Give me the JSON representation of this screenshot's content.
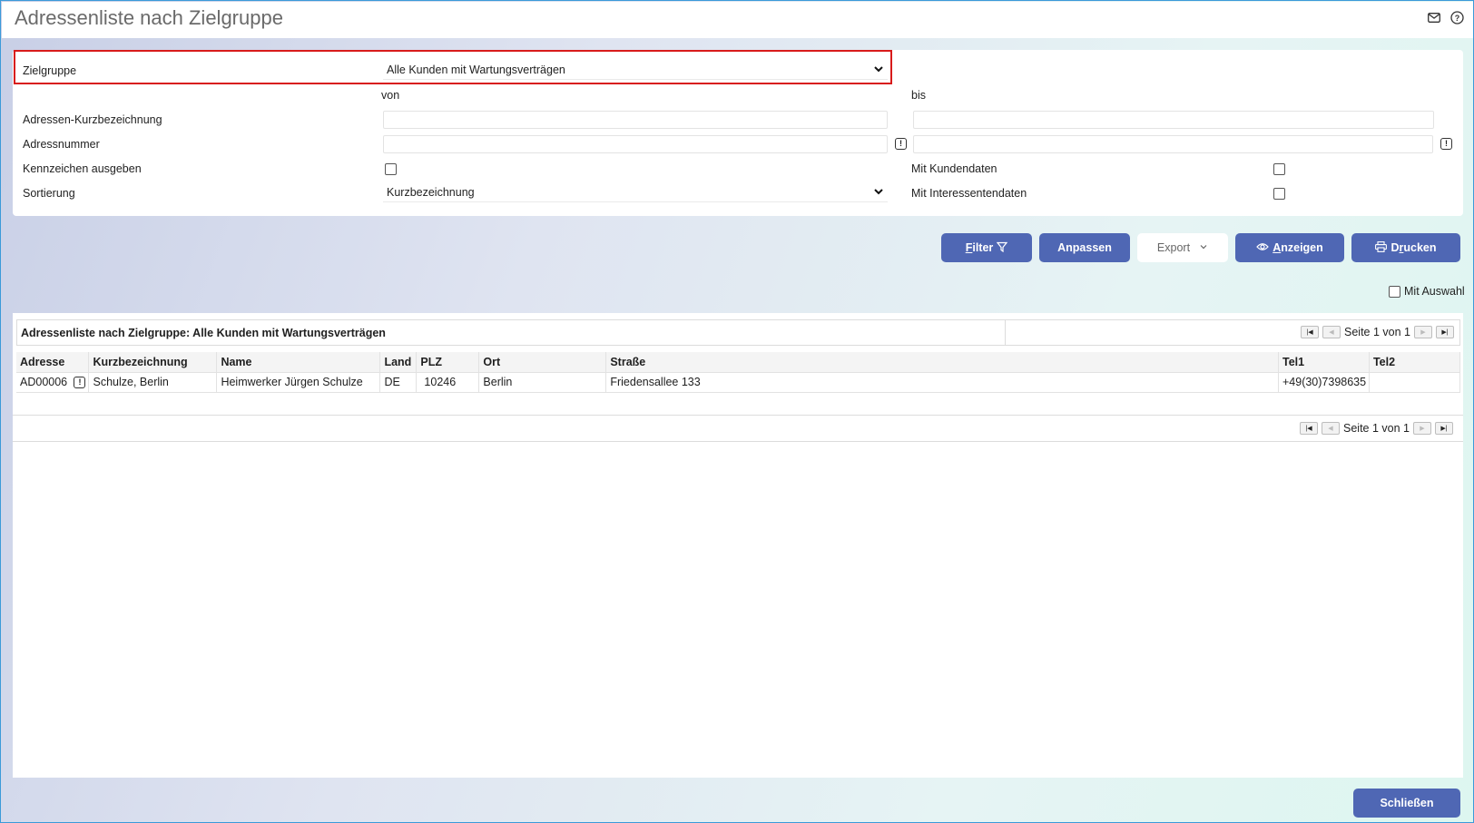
{
  "window": {
    "title": "Adressenliste nach Zielgruppe",
    "mail_icon": "mail-icon",
    "help_icon": "help-icon"
  },
  "filter": {
    "zielgruppe_label": "Zielgruppe",
    "zielgruppe_value": "Alle Kunden mit Wartungsverträgen",
    "von_label": "von",
    "bis_label": "bis",
    "kurzbezeichnung_label": "Adressen-Kurzbezeichnung",
    "kurzbezeichnung_von": "",
    "kurzbezeichnung_bis": "",
    "adressnummer_label": "Adressnummer",
    "adressnummer_von": "",
    "adressnummer_bis": "",
    "kennzeichen_label": "Kennzeichen ausgeben",
    "kennzeichen_checked": false,
    "sortierung_label": "Sortierung",
    "sortierung_value": "Kurzbezeichnung",
    "kundendaten_label": "Mit Kundendaten",
    "kundendaten_checked": false,
    "interessentendaten_label": "Mit Interessentendaten",
    "interessentendaten_checked": false,
    "highlight_color": "#d81b1b"
  },
  "toolbar": {
    "filter_label_accel": "F",
    "filter_label_rest": "ilter",
    "anpassen_label": "Anpassen",
    "export_label": "Export",
    "anzeigen_label_accel": "A",
    "anzeigen_label_rest": "nzeigen",
    "drucken_label_pre": "D",
    "drucken_label_accel": "r",
    "drucken_label_rest": "ucken",
    "mit_auswahl_label": "Mit Auswahl",
    "mit_auswahl_checked": false,
    "accent_color": "#4f67b4"
  },
  "grid": {
    "title": "Adressenliste nach Zielgruppe: Alle Kunden mit Wartungsverträgen",
    "pager_text": "Seite 1 von 1",
    "columns": [
      "Adresse",
      "Kurzbezeichnung",
      "Name",
      "Land",
      "PLZ",
      "Ort",
      "Straße",
      "Tel1",
      "Tel2"
    ],
    "rows": [
      {
        "adresse": "AD00006",
        "kurzbezeichnung": "Schulze, Berlin",
        "name": "Heimwerker Jürgen Schulze",
        "land": "DE",
        "plz": "10246",
        "ort": "Berlin",
        "strasse": "Friedensallee 133",
        "tel1": "+49(30)7398635",
        "tel2": ""
      }
    ]
  },
  "footer": {
    "close_label": "Schließen"
  }
}
